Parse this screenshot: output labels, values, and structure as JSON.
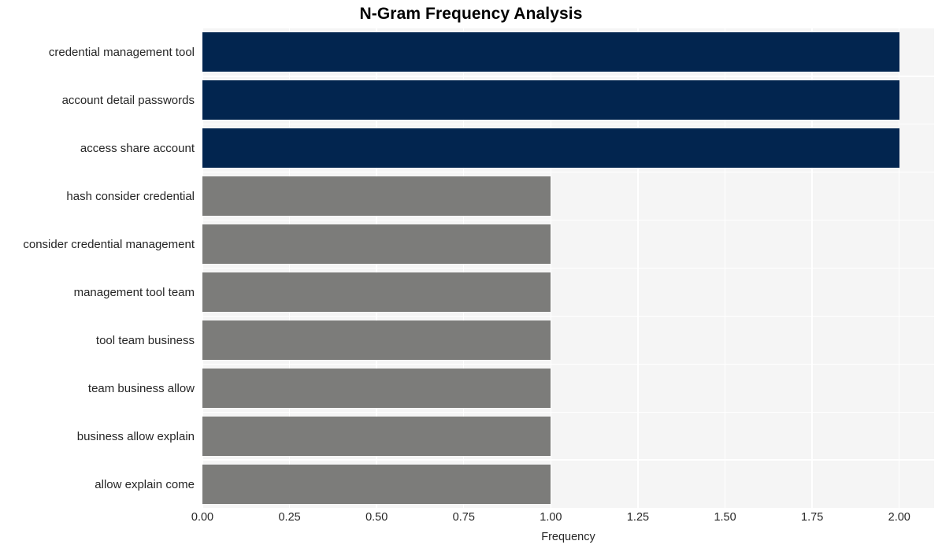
{
  "chart_data": {
    "type": "bar",
    "orientation": "horizontal",
    "title": "N-Gram Frequency Analysis",
    "xlabel": "Frequency",
    "ylabel": "",
    "categories": [
      "credential management tool",
      "account detail passwords",
      "access share account",
      "hash consider credential",
      "consider credential management",
      "management tool team",
      "tool team business",
      "team business allow",
      "business allow explain",
      "allow explain come"
    ],
    "values": [
      2,
      2,
      2,
      1,
      1,
      1,
      1,
      1,
      1,
      1
    ],
    "bar_colors": [
      "#02254f",
      "#02254f",
      "#02254f",
      "#7c7c7a",
      "#7c7c7a",
      "#7c7c7a",
      "#7c7c7a",
      "#7c7c7a",
      "#7c7c7a",
      "#7c7c7a"
    ],
    "xlim": [
      0,
      2.1
    ],
    "xticks": [
      0,
      0.25,
      0.5,
      0.75,
      1,
      1.25,
      1.5,
      1.75,
      2
    ],
    "xtick_labels": [
      "0.00",
      "0.25",
      "0.50",
      "0.75",
      "1.00",
      "1.25",
      "1.50",
      "1.75",
      "2.00"
    ],
    "grid": true,
    "grid_color": "#ffffff",
    "plot_background": "#f5f5f5",
    "figure_background": "#ffffff",
    "legend": null
  }
}
